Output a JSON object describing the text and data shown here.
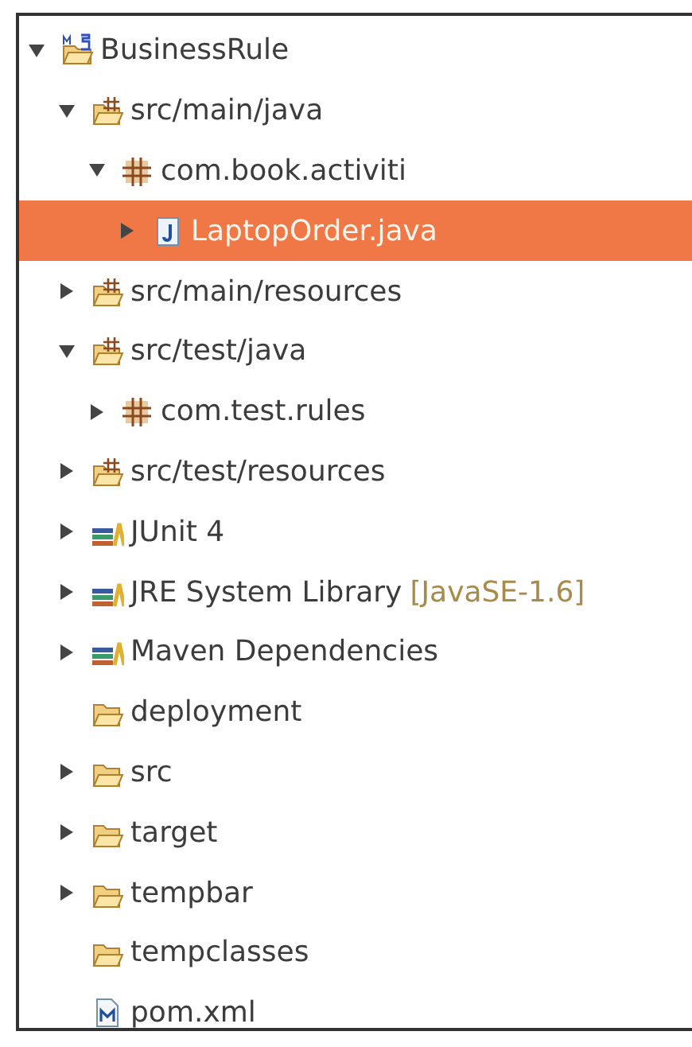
{
  "tree": [
    {
      "label": "BusinessRule",
      "kind": "project",
      "expanded": true,
      "selected": false,
      "children": [
        {
          "label": "src/main/java",
          "kind": "source-folder",
          "expanded": true,
          "selected": false,
          "children": [
            {
              "label": "com.book.activiti",
              "kind": "package",
              "expanded": true,
              "selected": false,
              "children": [
                {
                  "label": "LaptopOrder.java",
                  "kind": "java-file",
                  "expanded": false,
                  "selected": true
                }
              ]
            }
          ]
        },
        {
          "label": "src/main/resources",
          "kind": "source-folder",
          "expanded": false,
          "selected": false
        },
        {
          "label": "src/test/java",
          "kind": "source-folder",
          "expanded": true,
          "selected": false,
          "children": [
            {
              "label": "com.test.rules",
              "kind": "package",
              "expanded": false,
              "selected": false
            }
          ]
        },
        {
          "label": "src/test/resources",
          "kind": "source-folder",
          "expanded": false,
          "selected": false
        },
        {
          "label": "JUnit 4",
          "kind": "library",
          "expanded": false,
          "selected": false
        },
        {
          "label": "JRE System Library",
          "decoration": "[JavaSE-1.6]",
          "kind": "library",
          "expanded": false,
          "selected": false
        },
        {
          "label": "Maven Dependencies",
          "kind": "library",
          "expanded": false,
          "selected": false
        },
        {
          "label": "deployment",
          "kind": "folder",
          "selected": false
        },
        {
          "label": "src",
          "kind": "folder",
          "expanded": false,
          "selected": false
        },
        {
          "label": "target",
          "kind": "folder",
          "expanded": false,
          "selected": false
        },
        {
          "label": "tempbar",
          "kind": "folder",
          "expanded": false,
          "selected": false
        },
        {
          "label": "tempclasses",
          "kind": "folder",
          "selected": false
        },
        {
          "label": "pom.xml",
          "kind": "xml-file",
          "selected": false
        }
      ]
    }
  ]
}
